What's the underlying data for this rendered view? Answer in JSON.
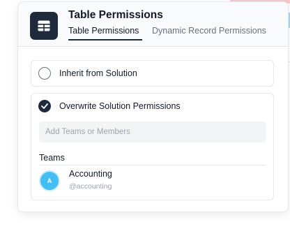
{
  "panel": {
    "title": "Table Permissions",
    "tabs": [
      {
        "label": "Table Permissions",
        "active": true
      },
      {
        "label": "Dynamic Record Permissions",
        "active": false
      }
    ]
  },
  "options": {
    "inherit": {
      "label": "Inherit from Solution",
      "checked": false
    },
    "overwrite": {
      "label": "Overwrite Solution Permissions",
      "checked": true
    }
  },
  "search": {
    "placeholder": "Add Teams or Members",
    "value": ""
  },
  "teams": {
    "heading": "Teams",
    "members": [
      {
        "initial": "A",
        "name": "Accounting",
        "handle": "@accounting",
        "avatar_color": "#44bdf0"
      }
    ]
  },
  "colors": {
    "accent": "#1f2a3c",
    "avatar": "#44bdf0",
    "header_bg": "#f9fafb"
  },
  "icons": {
    "app": "table-icon",
    "selected": "check-circle-icon",
    "unselected": "radio-empty-icon"
  }
}
